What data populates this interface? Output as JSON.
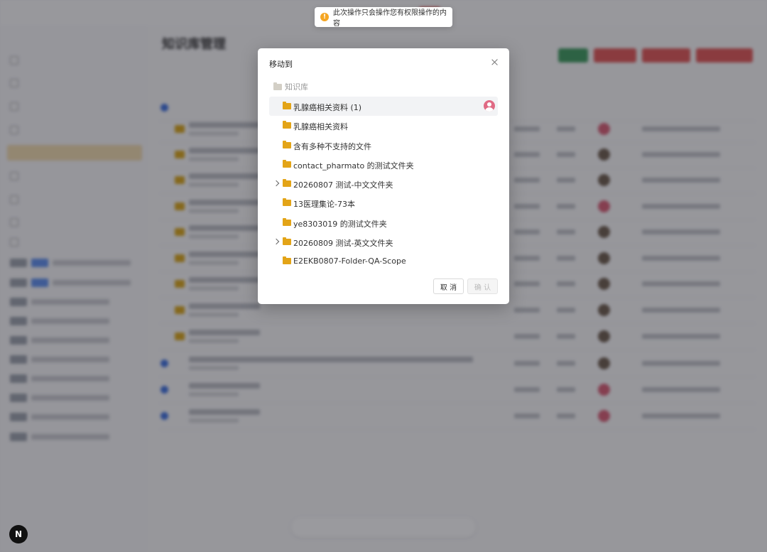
{
  "toast": {
    "message": "此次操作只会操作您有权限操作的内容"
  },
  "modal": {
    "title": "移动到",
    "root": "知识库",
    "folders": [
      {
        "label": "乳腺癌相关资料 (1)",
        "selected": true,
        "expandable": false,
        "has_avatar": true
      },
      {
        "label": "乳腺癌相关资料",
        "selected": false,
        "expandable": false,
        "has_avatar": false
      },
      {
        "label": "含有多种不支持的文件",
        "selected": false,
        "expandable": false,
        "has_avatar": false
      },
      {
        "label": "contact_pharmato 的测试文件夹",
        "selected": false,
        "expandable": false,
        "has_avatar": false
      },
      {
        "label": "20260807 测试-中文文件夹",
        "selected": false,
        "expandable": true,
        "has_avatar": false
      },
      {
        "label": "13医理集论-73本",
        "selected": false,
        "expandable": false,
        "has_avatar": false
      },
      {
        "label": "ye8303019 的测试文件夹",
        "selected": false,
        "expandable": false,
        "has_avatar": false
      },
      {
        "label": "20260809 测试-英文文件夹",
        "selected": false,
        "expandable": true,
        "has_avatar": false
      },
      {
        "label": "E2EKB0807-Folder-QA-Scope",
        "selected": false,
        "expandable": false,
        "has_avatar": false
      }
    ],
    "cancel_label": "取 消",
    "confirm_label": "确 认"
  },
  "background": {
    "page_title": "知识库管理",
    "next_badge": "N"
  }
}
